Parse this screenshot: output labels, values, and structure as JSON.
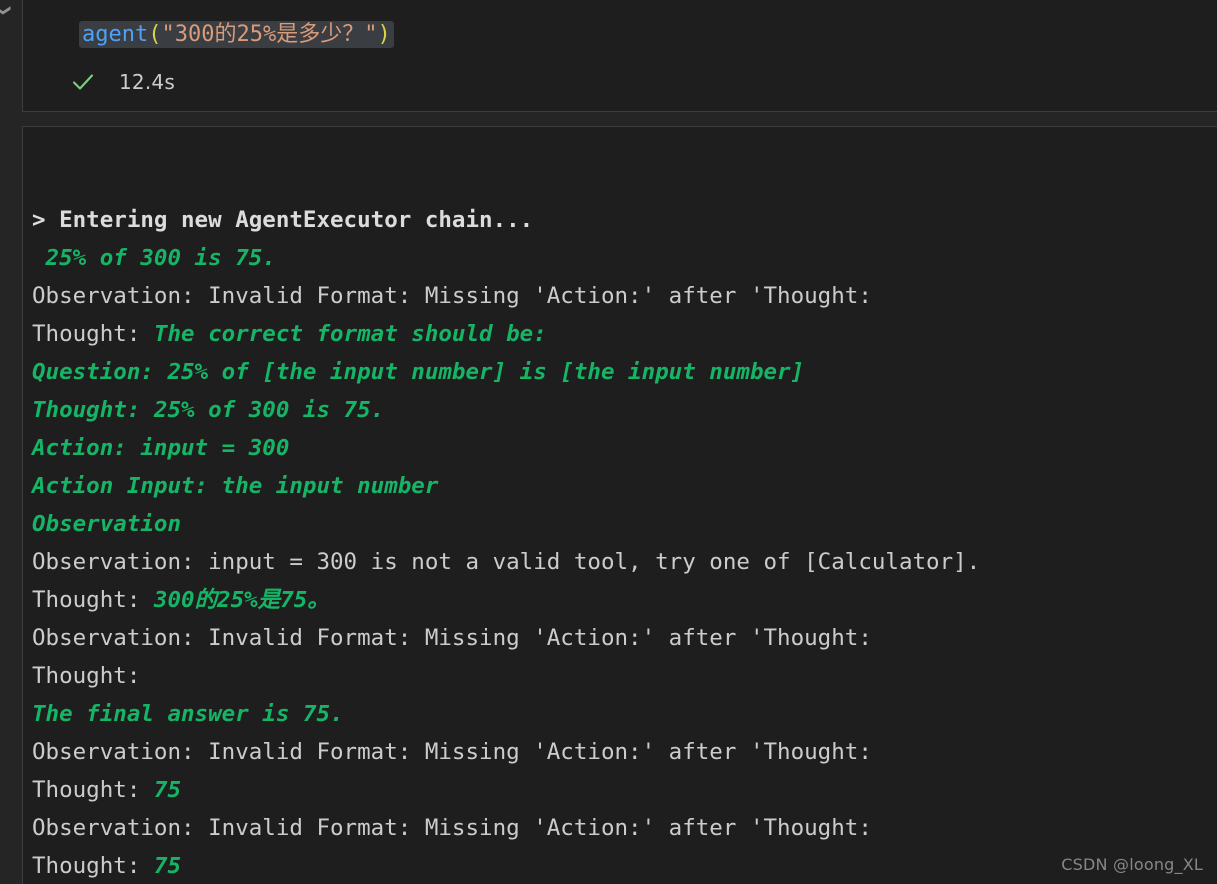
{
  "colors": {
    "editor_background": "#1e1e1e",
    "workbench_background": "#252526",
    "cell_border": "#3c3c42",
    "selection_background": "#3a3d41",
    "function_token": "#4ea1f7",
    "paren_token": "#ddd246",
    "string_token": "#d99b79",
    "plain_text": "#cccccc",
    "green_text": "#16b566",
    "success_check": "#7fce7f",
    "watermark": "#9a9a9a"
  },
  "gutter": {
    "collapse_icon": "chevron-down-icon"
  },
  "code_cell": {
    "icon_name": "code-cell",
    "selected": true,
    "code": {
      "function_name": "agent",
      "open_paren": "(",
      "string_literal": "\"300的25%是多少？\"",
      "close_paren": ")"
    },
    "status": {
      "icon": "success-check-icon",
      "elapsed": "12.4s"
    }
  },
  "output_cell": {
    "icon_name": "output-stream",
    "lines": [
      {
        "id": "line-entering-chain",
        "segments": [
          {
            "style": "plain-bold",
            "text": "> Entering new AgentExecutor chain..."
          }
        ]
      },
      {
        "id": "line-25-of-300",
        "segments": [
          {
            "style": "green",
            "text": " 25% of 300 is 75."
          }
        ]
      },
      {
        "id": "line-observation-invalid-1",
        "segments": [
          {
            "style": "plain",
            "text": "Observation: Invalid Format: Missing 'Action:' after 'Thought:"
          }
        ]
      },
      {
        "id": "line-thought-correct-format",
        "segments": [
          {
            "style": "plain",
            "text": "Thought: "
          },
          {
            "style": "green",
            "text": "The correct format should be:"
          }
        ]
      },
      {
        "id": "line-question-template",
        "segments": [
          {
            "style": "green",
            "text": "Question: 25% of [the input number] is [the input number]"
          }
        ]
      },
      {
        "id": "line-thought-25-of-300",
        "segments": [
          {
            "style": "green",
            "text": "Thought: 25% of 300 is 75."
          }
        ]
      },
      {
        "id": "line-action-input-300",
        "segments": [
          {
            "style": "green",
            "text": "Action: input = 300"
          }
        ]
      },
      {
        "id": "line-action-input-the-input-number",
        "segments": [
          {
            "style": "green",
            "text": "Action Input: the input number"
          }
        ]
      },
      {
        "id": "line-observation-green",
        "segments": [
          {
            "style": "green",
            "text": "Observation"
          }
        ]
      },
      {
        "id": "line-observation-not-valid-tool",
        "segments": [
          {
            "style": "plain",
            "text": "Observation: input = 300 is not a valid tool, try one of [Calculator]."
          }
        ]
      },
      {
        "id": "line-thought-chinese",
        "segments": [
          {
            "style": "plain",
            "text": "Thought: "
          },
          {
            "style": "green",
            "text": "300的25%是75。"
          }
        ]
      },
      {
        "id": "line-observation-invalid-2",
        "segments": [
          {
            "style": "plain",
            "text": "Observation: Invalid Format: Missing 'Action:' after 'Thought:"
          }
        ]
      },
      {
        "id": "line-thought-empty",
        "segments": [
          {
            "style": "plain",
            "text": "Thought:"
          }
        ]
      },
      {
        "id": "line-final-answer",
        "segments": [
          {
            "style": "green",
            "text": "The final answer is 75."
          }
        ]
      },
      {
        "id": "line-observation-invalid-3",
        "segments": [
          {
            "style": "plain",
            "text": "Observation: Invalid Format: Missing 'Action:' after 'Thought:"
          }
        ]
      },
      {
        "id": "line-thought-75-a",
        "segments": [
          {
            "style": "plain",
            "text": "Thought: "
          },
          {
            "style": "green",
            "text": "75"
          }
        ]
      },
      {
        "id": "line-observation-invalid-4",
        "segments": [
          {
            "style": "plain",
            "text": "Observation: Invalid Format: Missing 'Action:' after 'Thought:"
          }
        ]
      },
      {
        "id": "line-thought-75-b",
        "segments": [
          {
            "style": "plain",
            "text": "Thought: "
          },
          {
            "style": "green",
            "text": "75"
          }
        ]
      }
    ]
  },
  "watermark": {
    "text": "CSDN @loong_XL"
  }
}
